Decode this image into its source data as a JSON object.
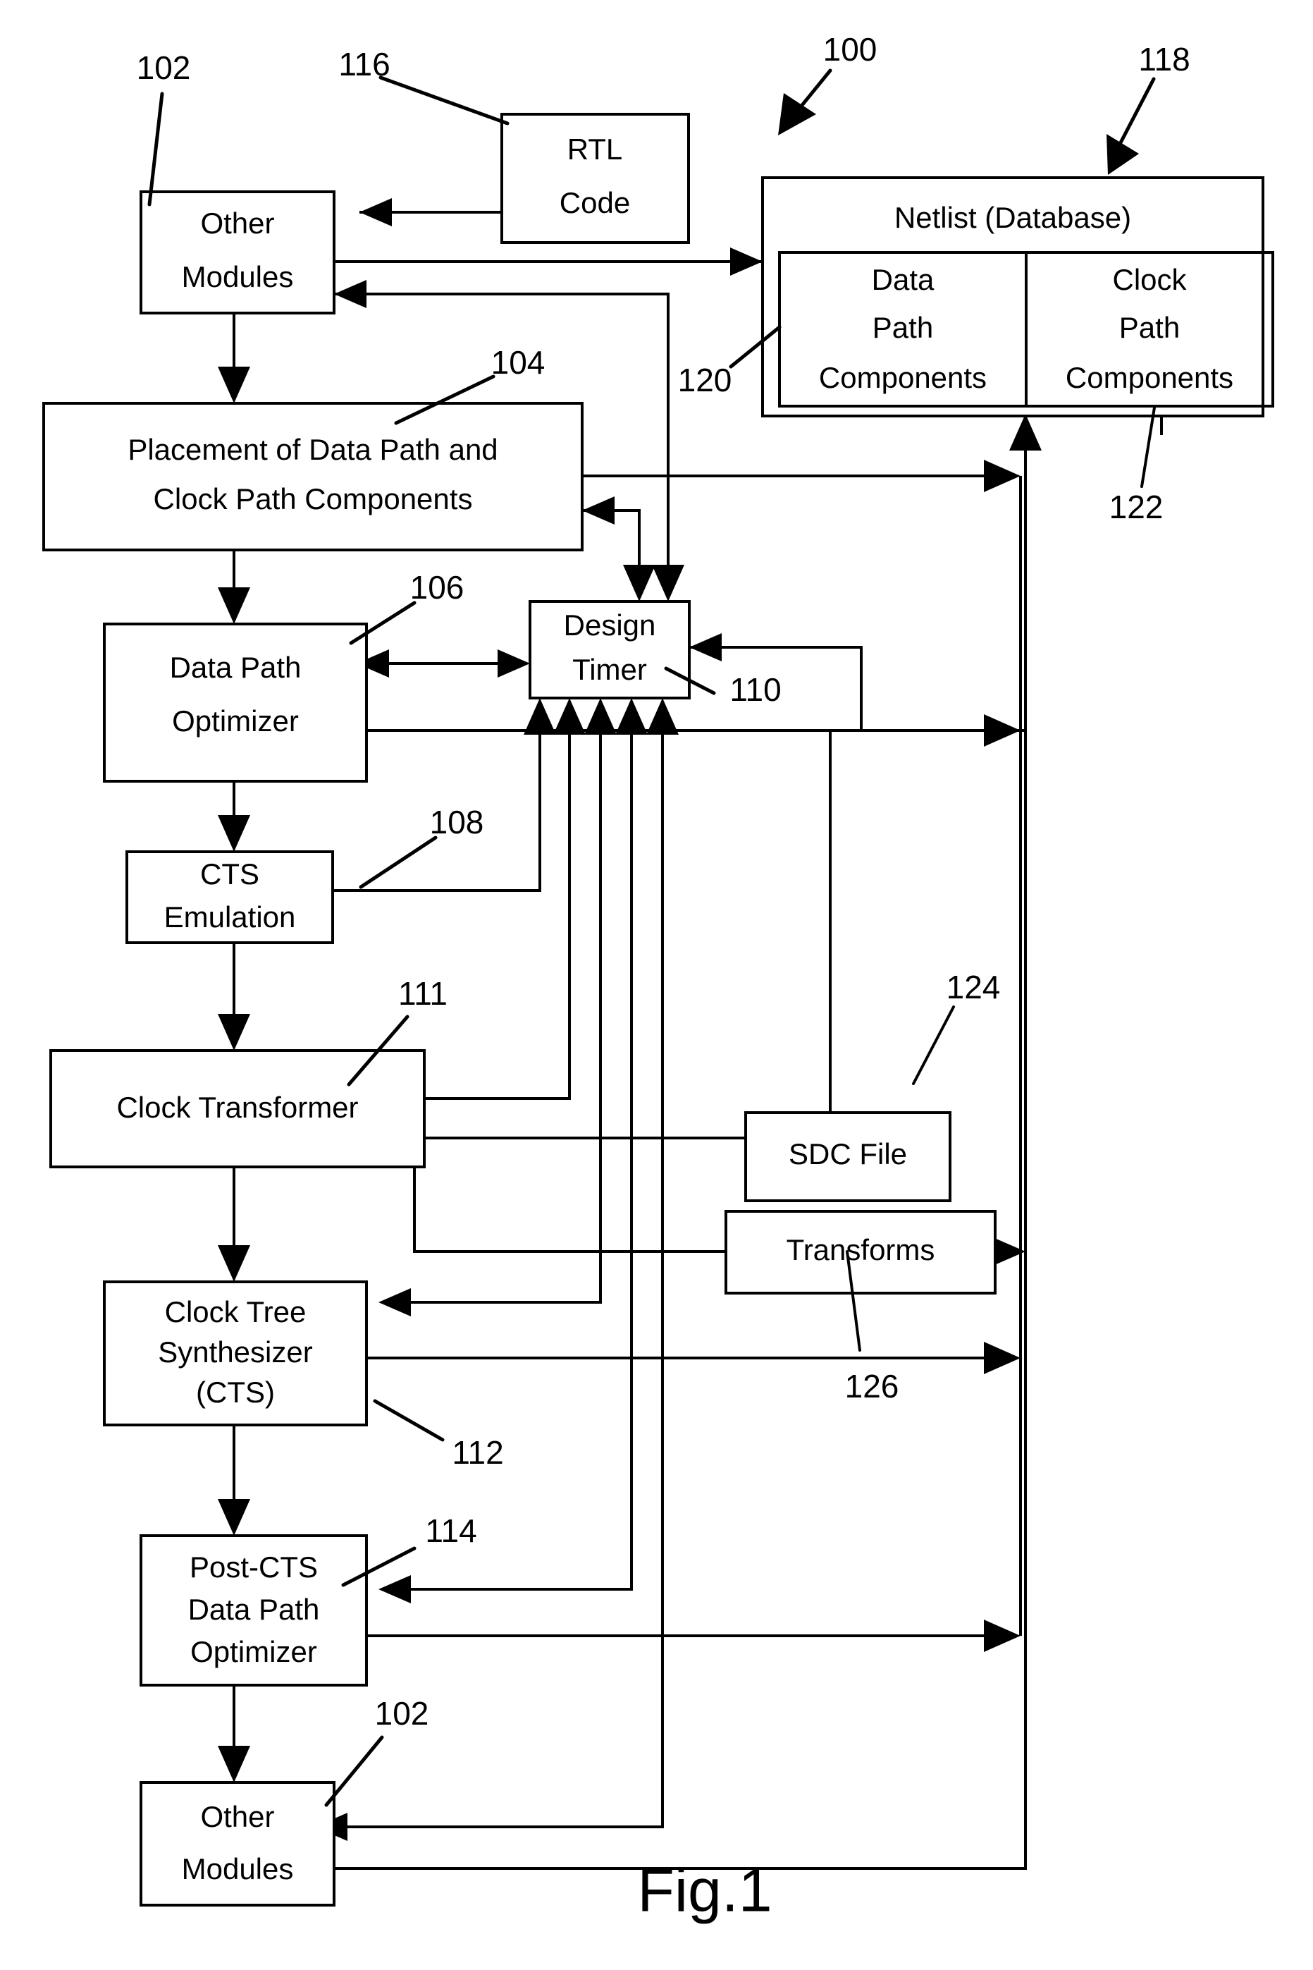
{
  "figure": {
    "caption": "Fig.1",
    "system_ref": "100"
  },
  "boxes": {
    "other_modules_top": {
      "lines": [
        "Other",
        "Modules"
      ],
      "ref": "102"
    },
    "rtl_code": {
      "lines": [
        "RTL",
        "Code"
      ],
      "ref": "116"
    },
    "netlist": {
      "title": "Netlist (Database)",
      "ref": "118"
    },
    "data_path_components": {
      "lines": [
        "Data",
        "Path",
        "Components"
      ],
      "ref": "120"
    },
    "clock_path_components": {
      "lines": [
        "Clock",
        "Path",
        "Components"
      ],
      "ref": "122"
    },
    "placement": {
      "lines": [
        "Placement of Data Path and",
        "Clock Path Components"
      ],
      "ref": "104"
    },
    "data_path_optimizer": {
      "lines": [
        "Data Path",
        "Optimizer"
      ],
      "ref": "106"
    },
    "design_timer": {
      "lines": [
        "Design",
        "Timer"
      ],
      "ref": "110"
    },
    "cts_emulation": {
      "lines": [
        "CTS",
        "Emulation"
      ],
      "ref": "108"
    },
    "clock_transformer": {
      "lines": [
        "Clock Transformer"
      ],
      "ref": "111"
    },
    "sdc_file": {
      "lines": [
        "SDC File"
      ],
      "ref": "124"
    },
    "transforms": {
      "lines": [
        "Transforms"
      ],
      "ref": "126"
    },
    "clock_tree_synthesizer": {
      "lines": [
        "Clock Tree",
        "Synthesizer",
        "(CTS)"
      ],
      "ref": "112"
    },
    "post_cts_optimizer": {
      "lines": [
        "Post-CTS",
        "Data Path",
        "Optimizer"
      ],
      "ref": "114"
    },
    "other_modules_bottom": {
      "lines": [
        "Other",
        "Modules"
      ],
      "ref": "102"
    }
  },
  "reference_numerals": [
    "102",
    "116",
    "100",
    "118",
    "104",
    "120",
    "122",
    "106",
    "110",
    "108",
    "111",
    "124",
    "126",
    "112",
    "114",
    "102"
  ],
  "colors": {
    "stroke": "#000000",
    "fill": "#ffffff"
  }
}
